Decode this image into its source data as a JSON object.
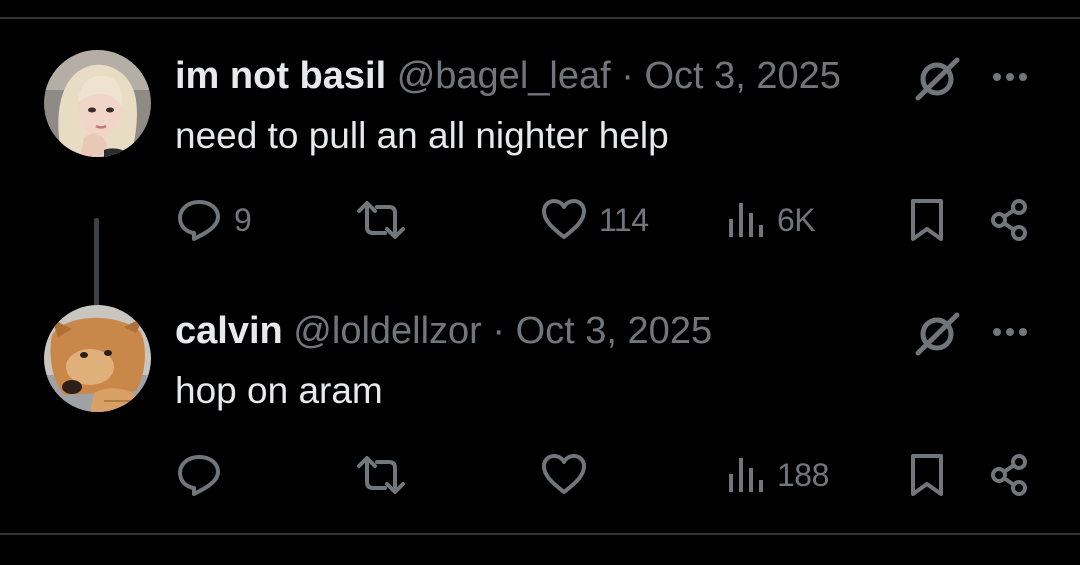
{
  "thread": [
    {
      "avatar_icon": "blonde-person-avatar",
      "display_name": "im not basil",
      "handle": "@bagel_leaf",
      "separator": "·",
      "date": "Oct 3, 2025",
      "text": "need to pull an all nighter help",
      "stats": {
        "replies": "9",
        "retweets": "",
        "likes": "114",
        "views": "6K"
      }
    },
    {
      "avatar_icon": "dog-avatar",
      "display_name": "calvin",
      "handle": "@loldellzor",
      "separator": "·",
      "date": "Oct 3, 2025",
      "text": "hop on aram",
      "stats": {
        "replies": "",
        "retweets": "",
        "likes": "",
        "views": "188"
      }
    }
  ],
  "icons": [
    "grok-icon",
    "more-icon",
    "reply-icon",
    "retweet-icon",
    "like-icon",
    "views-icon",
    "bookmark-icon",
    "share-icon"
  ],
  "colors": {
    "background": "#000000",
    "primary_text": "#e7e9ea",
    "secondary_text": "#71767b",
    "divider": "#2f3336"
  }
}
